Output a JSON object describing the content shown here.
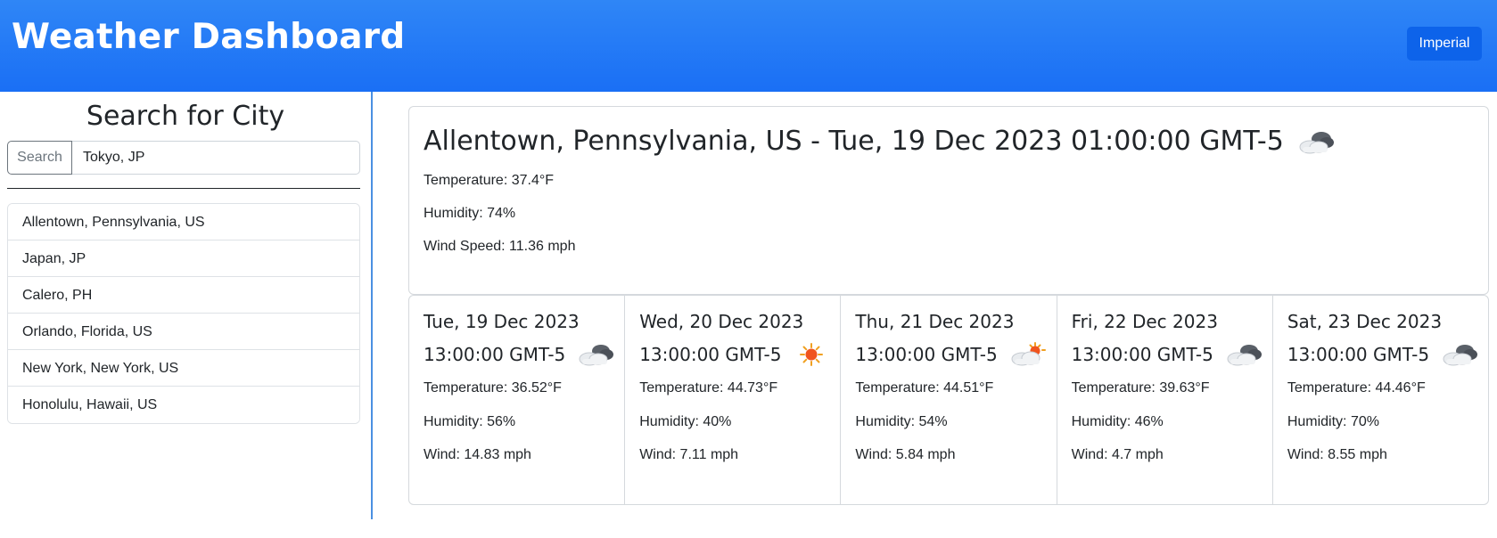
{
  "header": {
    "title": "Weather Dashboard",
    "units_label": "Imperial"
  },
  "sidebar": {
    "heading": "Search for City",
    "search_button": "Search",
    "search_value": "Tokyo, JP",
    "history": [
      "Allentown, Pennsylvania, US",
      "Japan, JP",
      "Calero, PH",
      "Orlando, Florida, US",
      "New York, New York, US",
      "Honolulu, Hawaii, US"
    ]
  },
  "current": {
    "title": "Allentown, Pennsylvania, US - Tue, 19 Dec 2023 01:00:00 GMT-5",
    "icon": "cloudy-night-icon",
    "temperature": "Temperature: 37.4°F",
    "humidity": "Humidity: 74%",
    "wind": "Wind Speed: 11.36 mph"
  },
  "forecast": [
    {
      "date": "Tue, 19 Dec 2023",
      "time": "13:00:00 GMT-5",
      "icon": "cloudy-icon",
      "temperature": "Temperature: 36.52°F",
      "humidity": "Humidity: 56%",
      "wind": "Wind: 14.83 mph"
    },
    {
      "date": "Wed, 20 Dec 2023",
      "time": "13:00:00 GMT-5",
      "icon": "sun-icon",
      "temperature": "Temperature: 44.73°F",
      "humidity": "Humidity: 40%",
      "wind": "Wind: 7.11 mph"
    },
    {
      "date": "Thu, 21 Dec 2023",
      "time": "13:00:00 GMT-5",
      "icon": "partly-cloudy-icon",
      "temperature": "Temperature: 44.51°F",
      "humidity": "Humidity: 54%",
      "wind": "Wind: 5.84 mph"
    },
    {
      "date": "Fri, 22 Dec 2023",
      "time": "13:00:00 GMT-5",
      "icon": "cloudy-icon",
      "temperature": "Temperature: 39.63°F",
      "humidity": "Humidity: 46%",
      "wind": "Wind: 4.7 mph"
    },
    {
      "date": "Sat, 23 Dec 2023",
      "time": "13:00:00 GMT-5",
      "icon": "cloudy-icon",
      "temperature": "Temperature: 44.46°F",
      "humidity": "Humidity: 70%",
      "wind": "Wind: 8.55 mph"
    }
  ],
  "colors": {
    "header_bg": "#1a6ff5",
    "units_button": "#0d63ea",
    "sidebar_divider": "#4a90e2",
    "border": "#d5d9dd"
  }
}
